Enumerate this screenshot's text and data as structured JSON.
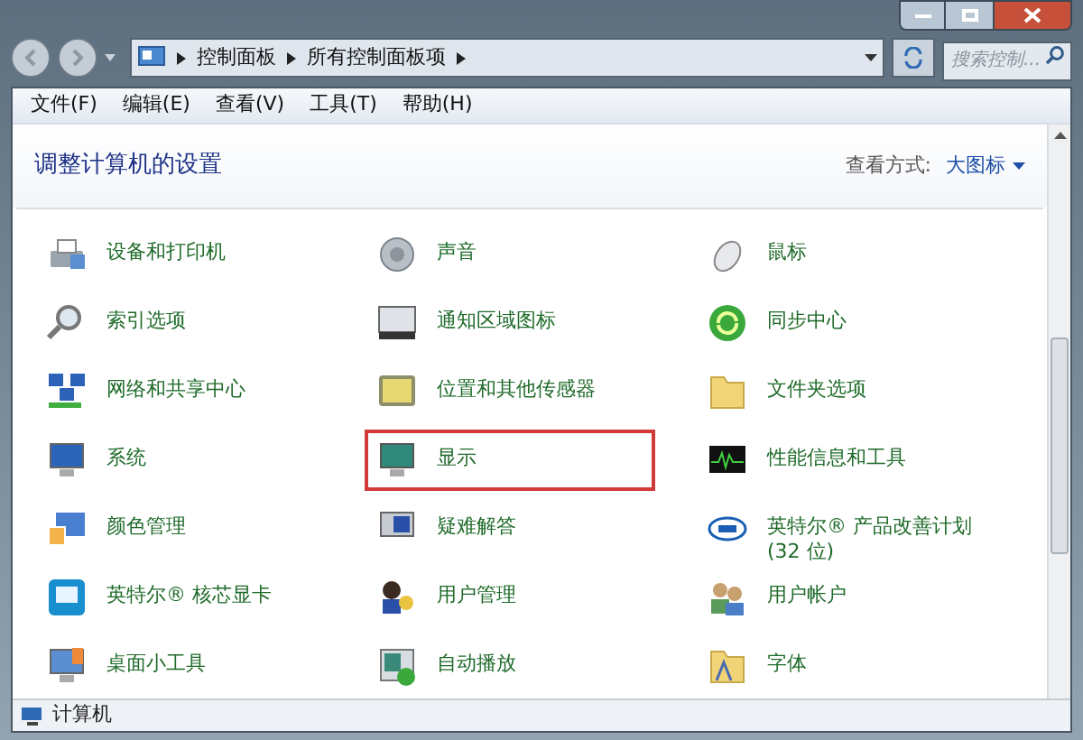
{
  "address_bar": {
    "path": [
      "控制面板",
      "所有控制面板项"
    ],
    "search": {
      "placeholder": "搜索控制..."
    }
  },
  "menu": [
    "文件(F)",
    "编辑(E)",
    "查看(V)",
    "工具(T)",
    "帮助(H)"
  ],
  "header": {
    "title": "调整计算机的设置",
    "view_label": "查看方式:",
    "view_value": "大图标"
  },
  "items": [
    {
      "label": "设备和打印机",
      "highlighted": false
    },
    {
      "label": "声音",
      "highlighted": false
    },
    {
      "label": "鼠标",
      "highlighted": false
    },
    {
      "label": "索引选项",
      "highlighted": false
    },
    {
      "label": "通知区域图标",
      "highlighted": false
    },
    {
      "label": "同步中心",
      "highlighted": false
    },
    {
      "label": "网络和共享中心",
      "highlighted": false
    },
    {
      "label": "位置和其他传感器",
      "highlighted": false
    },
    {
      "label": "文件夹选项",
      "highlighted": false
    },
    {
      "label": "系统",
      "highlighted": false
    },
    {
      "label": "显示",
      "highlighted": true
    },
    {
      "label": "性能信息和工具",
      "highlighted": false
    },
    {
      "label": "颜色管理",
      "highlighted": false
    },
    {
      "label": "疑难解答",
      "highlighted": false
    },
    {
      "label": "英特尔® 产品改善计划 (32 位)",
      "highlighted": false
    },
    {
      "label": "英特尔® 核芯显卡",
      "highlighted": false
    },
    {
      "label": "用户管理",
      "highlighted": false
    },
    {
      "label": "用户帐户",
      "highlighted": false
    },
    {
      "label": "桌面小工具",
      "highlighted": false
    },
    {
      "label": "自动播放",
      "highlighted": false
    },
    {
      "label": "字体",
      "highlighted": false
    }
  ],
  "status_bar": {
    "text": "计算机"
  }
}
